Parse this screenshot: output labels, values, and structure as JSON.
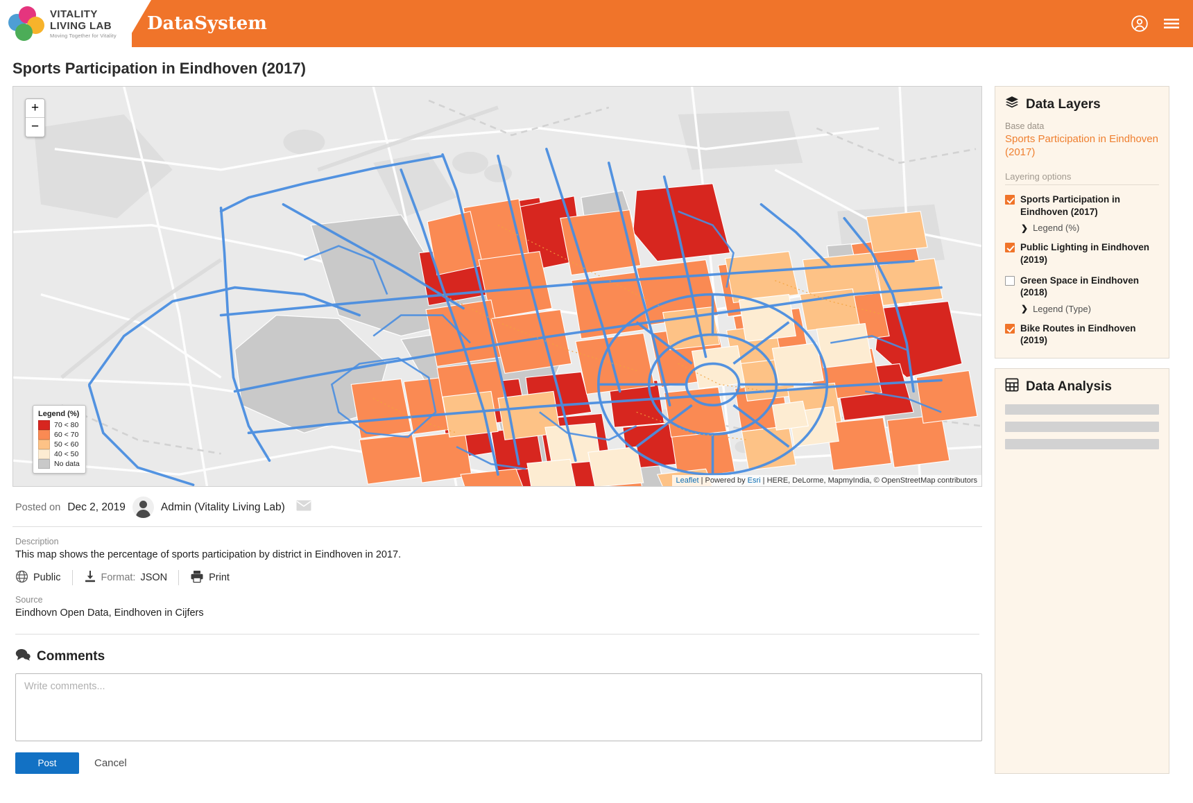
{
  "header": {
    "logo": {
      "line1": "VITALITY",
      "line2": "LIVING LAB",
      "tagline": "Moving Together for Vitality"
    },
    "brand": "DataSystem",
    "account_icon": "account-circle-icon",
    "menu_icon": "hamburger-menu-icon",
    "background_color": "#f0742a"
  },
  "page_title": "Sports Participation in Eindhoven (2017)",
  "map": {
    "zoom_in_label": "+",
    "zoom_out_label": "−",
    "legend": {
      "title": "Legend (%)",
      "items": [
        {
          "label": "70 < 80",
          "color": "#d7261f"
        },
        {
          "label": "60 < 70",
          "color": "#fa8a53"
        },
        {
          "label": "50 < 60",
          "color": "#fdc286"
        },
        {
          "label": "40 < 50",
          "color": "#fdecd2"
        },
        {
          "label": "No data",
          "color": "#c9c9c9"
        }
      ]
    },
    "attribution": {
      "leaflet": "Leaflet",
      "sep1": " | Powered by ",
      "esri": "Esri",
      "rest": " | HERE, DeLorme, MapmyIndia, © OpenStreetMap contributors"
    },
    "bike_route_color": "#4a8ee0"
  },
  "meta": {
    "posted_label": "Posted on",
    "posted_date": "Dec 2, 2019",
    "author": "Admin (Vitality Living Lab)",
    "avatar_icon": "user-avatar-icon",
    "email_icon": "envelope-icon",
    "description_label": "Description",
    "description": "This map shows the percentage of sports participation by district in Eindhoven in 2017.",
    "visibility_label": "Public",
    "visibility_icon": "globe-icon",
    "format_label": "Format:",
    "format_value": "JSON",
    "download_icon": "download-icon",
    "print_label": "Print",
    "print_icon": "printer-icon",
    "source_label": "Source",
    "source_value": "Eindhovn Open Data, Eindhoven in Cijfers"
  },
  "comments": {
    "heading": "Comments",
    "heading_icon": "comments-icon",
    "placeholder": "Write comments...",
    "value": "",
    "post_label": "Post",
    "cancel_label": "Cancel",
    "post_color": "#1271c4"
  },
  "data_layers": {
    "heading": "Data Layers",
    "heading_icon": "layers-icon",
    "base_data_label": "Base data",
    "base_data_value": "Sports Participation in Eindhoven (2017)",
    "layering_label": "Layering options",
    "items": [
      {
        "label": "Sports Participation in Eindhoven (2017)",
        "checked": true,
        "legend_link": "Legend (%)"
      },
      {
        "label": "Public Lighting in Eindhoven (2019)",
        "checked": true,
        "legend_link": ""
      },
      {
        "label": "Green Space in Eindhoven (2018)",
        "checked": false,
        "legend_link": "Legend (Type)"
      },
      {
        "label": "Bike Routes in Eindhoven (2019)",
        "checked": true,
        "legend_link": ""
      }
    ],
    "accent_color": "#f0742a"
  },
  "data_analysis": {
    "heading": "Data Analysis",
    "heading_icon": "calculator-icon",
    "placeholder_bars": 3
  }
}
